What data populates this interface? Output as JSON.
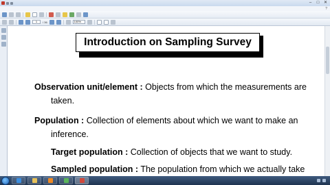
{
  "window": {
    "title": "",
    "minimize": "–",
    "maximize": "□",
    "close": "✕"
  },
  "menu": {
    "items": [],
    "help_glyph": "?"
  },
  "toolbar": {
    "page_number": "1",
    "page_total": "/ 36",
    "zoom": "100%"
  },
  "slide": {
    "title": "Introduction on Sampling Survey",
    "lines": [
      {
        "term": "Observation unit/element :",
        "text": " Objects from which the measurements are"
      },
      {
        "term": "",
        "text": "taken."
      },
      {
        "term": "Population :",
        "text": " Collection of elements about which we want to make an"
      },
      {
        "term": "",
        "text": "inference."
      },
      {
        "term": "Target population :",
        "text": " Collection of objects that we want to study."
      },
      {
        "term": "Sampled population :",
        "text": " The population from which we actually take"
      }
    ]
  },
  "taskbar": {
    "clock_time": "",
    "clock_date": ""
  },
  "icons": {
    "start": "windows-start-icon",
    "app": "pdf-reader-icon"
  },
  "colors": {
    "taskbar": "#2a4468",
    "toolbar": "#e6ecf4",
    "title_shadow": "#000000"
  }
}
